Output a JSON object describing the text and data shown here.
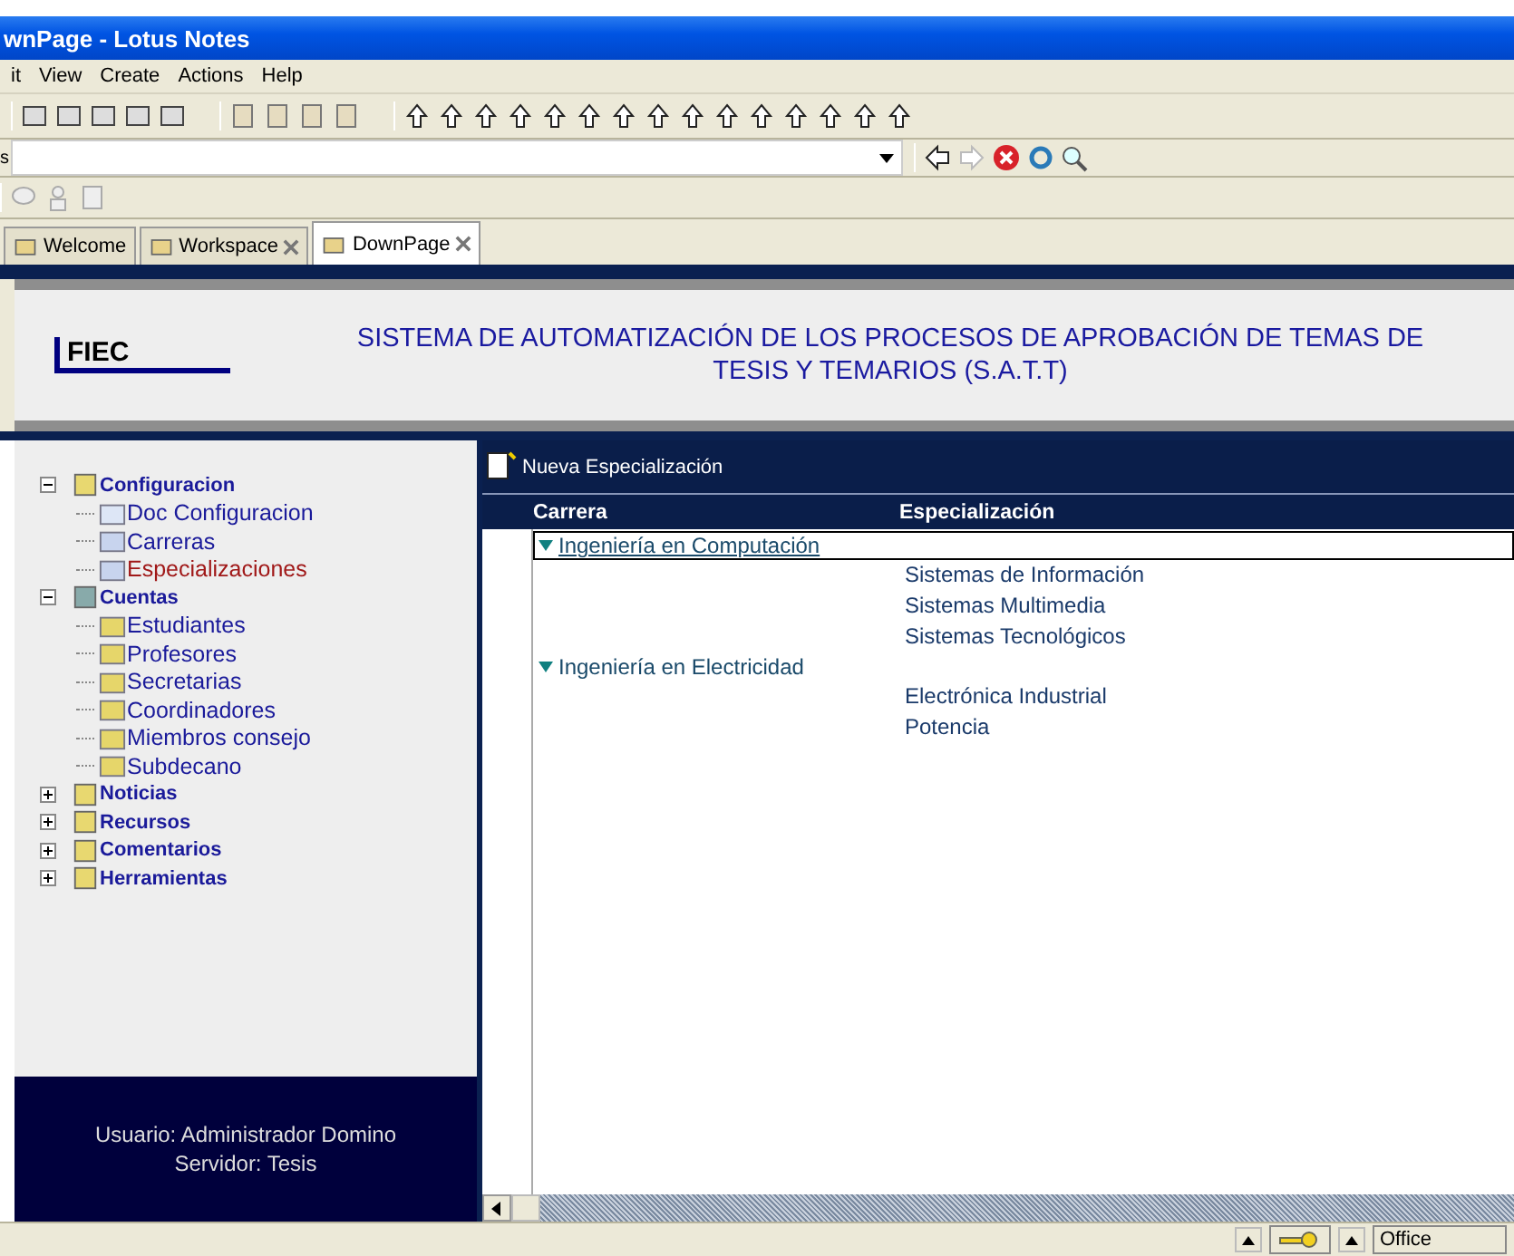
{
  "window": {
    "title": "wnPage - Lotus Notes"
  },
  "menu": [
    "it",
    "View",
    "Create",
    "Actions",
    "Help"
  ],
  "address": {
    "label": "s"
  },
  "tabs": [
    {
      "label": "Welcome",
      "closable": false,
      "selected": false
    },
    {
      "label": "Workspace",
      "closable": true,
      "selected": false
    },
    {
      "label": "DownPage",
      "closable": true,
      "selected": true
    }
  ],
  "header": {
    "logo": "FIEC",
    "title_line_1": "SISTEMA DE AUTOMATIZACIÓN DE LOS PROCESOS DE APROBACIÓN DE TEMAS DE",
    "title_line_2": "TESIS Y TEMARIOS (S.A.T.T)"
  },
  "sidebar": {
    "items": [
      {
        "label": "Configuracion",
        "kind": "config",
        "expanded": true,
        "selected": false,
        "children": [
          {
            "label": "Doc Configuracion",
            "kind": "doc",
            "selected": false
          },
          {
            "label": "Carreras",
            "kind": "view",
            "selected": false
          },
          {
            "label": "Especializaciones",
            "kind": "view",
            "selected": true
          }
        ]
      },
      {
        "label": "Cuentas",
        "kind": "people",
        "expanded": true,
        "selected": false,
        "children": [
          {
            "label": "Estudiantes",
            "kind": "card",
            "selected": false
          },
          {
            "label": "Profesores",
            "kind": "card",
            "selected": false
          },
          {
            "label": "Secretarias",
            "kind": "card",
            "selected": false
          },
          {
            "label": "Coordinadores",
            "kind": "card",
            "selected": false
          },
          {
            "label": "Miembros consejo",
            "kind": "card",
            "selected": false
          },
          {
            "label": "Subdecano",
            "kind": "card",
            "selected": false
          }
        ]
      },
      {
        "label": "Noticias",
        "kind": "news",
        "expanded": false,
        "selected": false
      },
      {
        "label": "Recursos",
        "kind": "resource",
        "expanded": false,
        "selected": false
      },
      {
        "label": "Comentarios",
        "kind": "comment",
        "expanded": false,
        "selected": false
      },
      {
        "label": "Herramientas",
        "kind": "tools",
        "expanded": false,
        "selected": false
      }
    ],
    "footer": [
      "Usuario: Administrador Domino",
      "Servidor: Tesis"
    ]
  },
  "action_bar": {
    "button": "Nueva Especialización"
  },
  "table": {
    "columns": [
      "Carrera",
      "Especialización"
    ],
    "rows": [
      {
        "carrera": "Ingeniería en Computación",
        "expanded": true,
        "selected": true,
        "children": [
          "Sistemas de Información",
          "Sistemas Multimedia",
          "Sistemas Tecnológicos"
        ]
      },
      {
        "carrera": "Ingeniería en Electricidad",
        "expanded": true,
        "selected": false,
        "children": [
          "Electrónica Industrial",
          "Potencia"
        ]
      }
    ]
  },
  "status_bar": {
    "location": "Office"
  }
}
